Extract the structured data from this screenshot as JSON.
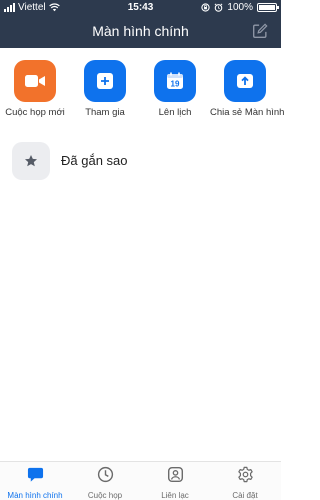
{
  "status_bar": {
    "carrier": "Viettel",
    "time": "15:43",
    "battery": "100%",
    "battery_level": 1.0
  },
  "header": {
    "title": "Màn hình chính",
    "edit_icon": "edit-icon"
  },
  "actions": [
    {
      "label": "Cuộc họp mới",
      "icon": "video-camera-icon",
      "color": "#f2722b"
    },
    {
      "label": "Tham gia",
      "icon": "plus-icon",
      "color": "#0e72ed"
    },
    {
      "label": "Lên lịch",
      "icon": "calendar-icon",
      "day": "19",
      "color": "#0e72ed"
    },
    {
      "label": "Chia sẻ Màn hình",
      "icon": "share-screen-icon",
      "color": "#0e72ed"
    }
  ],
  "starred": {
    "label": "Đã gắn sao",
    "icon": "star-icon"
  },
  "tabs": [
    {
      "label": "Màn hình chính",
      "icon": "chat-bubble-icon",
      "active": true
    },
    {
      "label": "Cuộc họp",
      "icon": "clock-icon",
      "active": false
    },
    {
      "label": "Liên lạc",
      "icon": "contact-icon",
      "active": false
    },
    {
      "label": "Cài đặt",
      "icon": "gear-icon",
      "active": false
    }
  ],
  "colors": {
    "header_bg": "#2d3a4e",
    "accent": "#0e72ed",
    "orange": "#f2722b"
  }
}
